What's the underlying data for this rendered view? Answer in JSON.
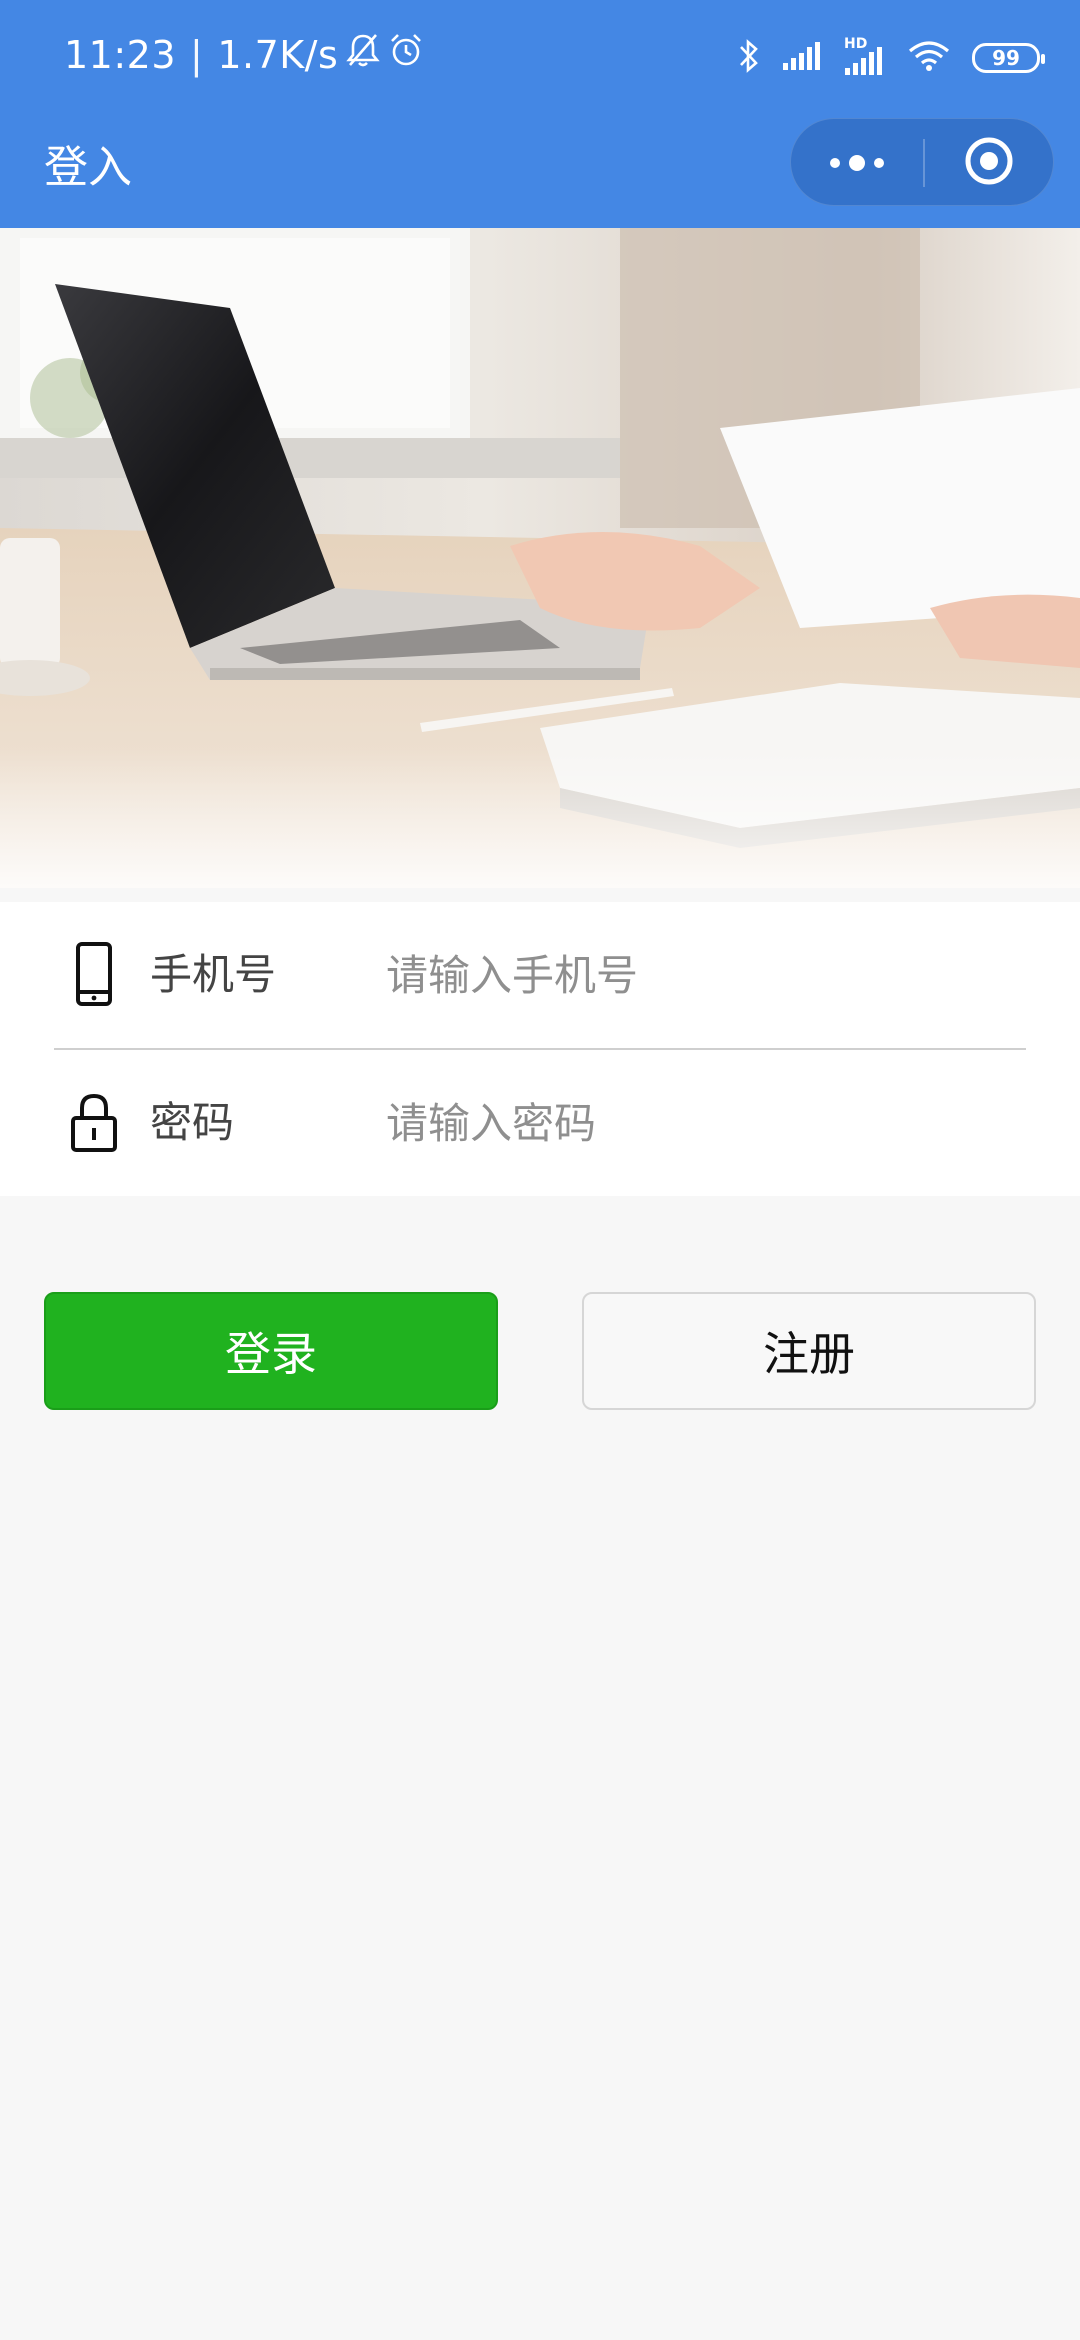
{
  "status_bar": {
    "time": "11:23",
    "separator": "|",
    "net_speed": "1.7K/s",
    "hd_label": "HD",
    "battery": "99"
  },
  "nav": {
    "title": "登入"
  },
  "hero": {
    "icon": "laptop-desk-photo"
  },
  "form": {
    "phone": {
      "label": "手机号",
      "placeholder": "请输入手机号",
      "value": "",
      "icon": "phone-icon"
    },
    "password": {
      "label": "密码",
      "placeholder": "请输入密码",
      "value": "",
      "icon": "lock-icon"
    }
  },
  "actions": {
    "login_label": "登录",
    "register_label": "注册"
  },
  "colors": {
    "header_bg": "#4487e4",
    "login_button": "#20b21f",
    "page_bg": "#f7f7f7"
  }
}
